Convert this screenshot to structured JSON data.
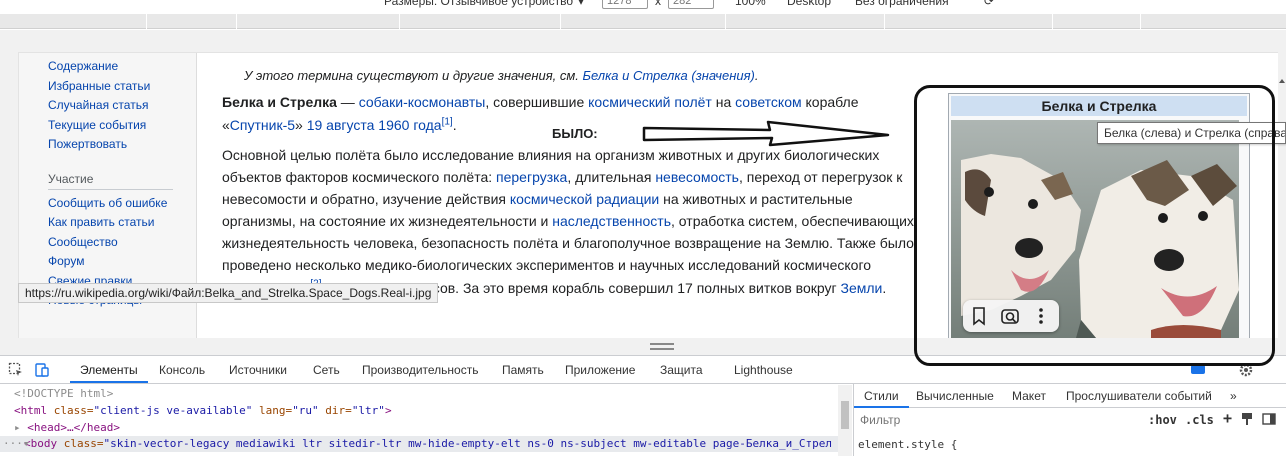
{
  "device_toolbar": {
    "dimensions_label": "Размеры: Отзывчивое устройство",
    "width_value": "1278",
    "x_sep": "x",
    "height_value": "282",
    "zoom": "100%",
    "mode": "Desktop",
    "throttle": "Без ограничения"
  },
  "sidebar": {
    "items": [
      {
        "label": "Содержание"
      },
      {
        "label": "Избранные статьи"
      },
      {
        "label": "Случайная статья"
      },
      {
        "label": "Текущие события"
      },
      {
        "label": "Пожертвовать"
      }
    ],
    "section_heading": "Участие",
    "section_items": [
      {
        "label": "Сообщить об ошибке"
      },
      {
        "label": "Как править статьи"
      },
      {
        "label": "Сообщество"
      },
      {
        "label": "Форум"
      },
      {
        "label": "Свежие правки"
      },
      {
        "label": "Новые страницы"
      }
    ]
  },
  "article": {
    "hatnote_text": "У этого термина существуют и другие значения, см.",
    "hatnote_link": "Белка и Стрелка (значения)",
    "p1": {
      "bold": "Белка и Стрелка",
      "t1": " — ",
      "l1": "собаки-космонавты",
      "t2": ", совершившие ",
      "l2": "космический полёт",
      "t3": " на ",
      "l3": "советском",
      "t4": " корабле",
      "t5": "«",
      "l4": "Спутник-5",
      "t6": "» ",
      "l5": "19 августа 1960 года",
      "ref1": "[1]",
      "t7": "."
    },
    "bylo_label": "БЫЛО:",
    "p2": {
      "line1": "Основной целью полёта было исследование влияния на организм животных и других биологических",
      "l2a": "объектов факторов космического полёта: ",
      "l2link1": "перегрузка",
      "l2b": ", длительная ",
      "l2link2": "невесомость",
      "l2c": ", переход от перегрузок к",
      "l3a": "невесомости и обратно, изучение действия ",
      "l3link": "космической радиации",
      "l3b": " на животных и растительные",
      "l4a": "организмы, на состояние их жизнедеятельности и ",
      "l4link": "наследственность",
      "l4b": ", отработка систем, обеспечивающих",
      "line5": "жизнедеятельность человека, безопасность полёта и благополучное возвращение на Землю. Также было",
      "line6": "проведено несколько медико-биологических экспериментов и научных исследований космического",
      "line7": "пространства",
      "ref2": "[2]",
      "line7end": "."
    },
    "p3": {
      "visible_text": "асов. За это время корабль совершил 17 полных витков вокруг ",
      "link": "Земли",
      "end": "."
    }
  },
  "infobox": {
    "title": "Белка и Стрелка",
    "image_caption_tooltip": "Белка (слева) и Стрелка (справа)"
  },
  "status_bar_url": "https://ru.wikipedia.org/wiki/Файл:Belka_and_Strelka.Space_Dogs.Real-i.jpg",
  "devtools": {
    "tabs": [
      {
        "label": "Элементы"
      },
      {
        "label": "Консоль"
      },
      {
        "label": "Источники"
      },
      {
        "label": "Сеть"
      },
      {
        "label": "Производительность"
      },
      {
        "label": "Память"
      },
      {
        "label": "Приложение"
      },
      {
        "label": "Защита"
      },
      {
        "label": "Lighthouse"
      }
    ],
    "code": {
      "doctype": "<!DOCTYPE html>",
      "html_open": "<html",
      "html_attr1": " class=",
      "html_val1": "\"client-js ve-available\"",
      "html_attr2": " lang=",
      "html_val2": "\"ru\"",
      "html_attr3": " dir=",
      "html_val3": "\"ltr\"",
      "html_close": ">",
      "head": "<head>…</head>",
      "body_open": "<body",
      "body_attr": " class=",
      "body_val": "\"skin-vector-legacy mediawiki ltr sitedir-ltr mw-hide-empty-elt ns-0 ns-subject mw-editable page-Белка_и_Стрел"
    },
    "styles_tabs": [
      {
        "label": "Стили"
      },
      {
        "label": "Вычисленные"
      },
      {
        "label": "Макет"
      },
      {
        "label": "Прослушиватели событий"
      },
      {
        "label": "»"
      }
    ],
    "filter_placeholder": "Фильтр",
    "hov_label": ":hov",
    "cls_label": ".cls",
    "element_style": "element.style {"
  },
  "colors": {
    "link": "#0645ad",
    "accent": "#1a73e8",
    "infobox_header": "#cedff2"
  },
  "icons": [
    "inspect-icon",
    "device-toggle-icon",
    "bookmark-icon",
    "lens-icon",
    "more-vert-icon",
    "chat-badge-icon",
    "settings-icon",
    "plus-icon",
    "paint-icon",
    "sidebar-toggle-icon"
  ]
}
